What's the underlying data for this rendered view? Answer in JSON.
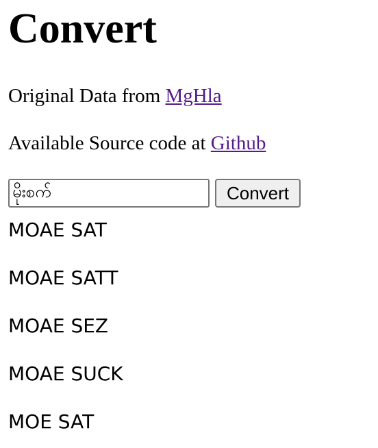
{
  "page": {
    "title": "Convert",
    "original_data": {
      "prefix": "Original Data from ",
      "link_text": "MgHla"
    },
    "source_code": {
      "prefix": "Available Source code at ",
      "link_text": "Github"
    }
  },
  "converter": {
    "input_value": "မိုးစက်",
    "button_label": "Convert"
  },
  "results": [
    "MOAE SAT",
    "MOAE SATT",
    "MOAE SEZ",
    "MOAE SUCK",
    "MOE SAT"
  ],
  "colors": {
    "link": "#551a8b",
    "button_bg": "#efefef",
    "border": "#767676"
  }
}
